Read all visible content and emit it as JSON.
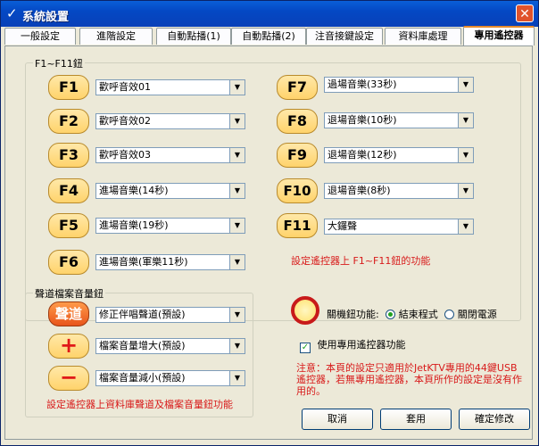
{
  "window": {
    "title": "系統設置",
    "title_icon": "check-icon"
  },
  "tabs": [
    {
      "label": "一般設定"
    },
    {
      "label": "進階設定"
    },
    {
      "label": "自動點播(1)"
    },
    {
      "label": "自動點播(2)"
    },
    {
      "label": "注音接鍵設定"
    },
    {
      "label": "資料庫處理"
    },
    {
      "label": "專用遙控器"
    }
  ],
  "fkeys_group": {
    "label": "F1~F11鈕",
    "keys": [
      {
        "key": "F1",
        "value": "歡呼音效01"
      },
      {
        "key": "F2",
        "value": "歡呼音效02"
      },
      {
        "key": "F3",
        "value": "歡呼音效03"
      },
      {
        "key": "F4",
        "value": "進場音樂(14秒)"
      },
      {
        "key": "F5",
        "value": "進場音樂(19秒)"
      },
      {
        "key": "F6",
        "value": "進場音樂(軍樂11秒)"
      },
      {
        "key": "F7",
        "value": "過場音樂(33秒)"
      },
      {
        "key": "F8",
        "value": "退場音樂(10秒)"
      },
      {
        "key": "F9",
        "value": "退場音樂(12秒)"
      },
      {
        "key": "F10",
        "value": "退場音樂(8秒)"
      },
      {
        "key": "F11",
        "value": "大鑼聲"
      }
    ],
    "note": "設定遙控器上 F1~F11鈕的功能"
  },
  "audio_group": {
    "label": "聲道檔案音量鈕",
    "items": [
      {
        "key": "聲道",
        "value": "修正伴唱聲道(預設)"
      },
      {
        "key": "+",
        "value": "檔案音量增大(預設)"
      },
      {
        "key": "−",
        "value": "檔案音量減小(預設)"
      }
    ],
    "note": "設定遙控器上資料庫聲道及檔案音量鈕功能"
  },
  "power": {
    "label": "關機鈕功能:",
    "options": [
      {
        "label": "結束程式",
        "selected": true
      },
      {
        "label": "關閉電源",
        "selected": false
      }
    ]
  },
  "use_remote": {
    "label": "使用專用遙控器功能",
    "checked": true
  },
  "notice": "注意：本頁的設定只適用於JetKTV專用的44鍵USB遙控器，若無專用遙控器，本頁所作的設定是沒有作用的。",
  "buttons": {
    "cancel": "取消",
    "apply": "套用",
    "confirm": "確定修改"
  },
  "colors": {
    "title_bar": "#0448c4",
    "accent_tab": "#e68b2c",
    "note_red": "#d81a1a",
    "fkey_fill": "#ffd36b"
  }
}
